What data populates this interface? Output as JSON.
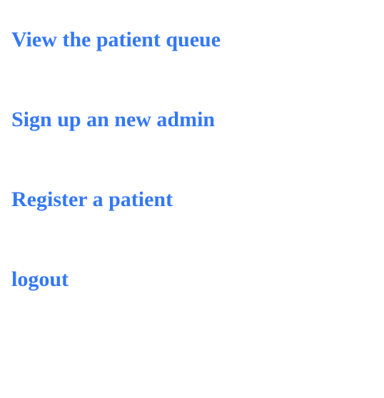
{
  "theme": {
    "link_color": "#3478f6",
    "background": "#ffffff"
  },
  "menu": {
    "items": [
      {
        "label": "View the patient queue"
      },
      {
        "label": "Sign up an new admin"
      },
      {
        "label": "Register a patient"
      },
      {
        "label": "logout"
      }
    ]
  }
}
